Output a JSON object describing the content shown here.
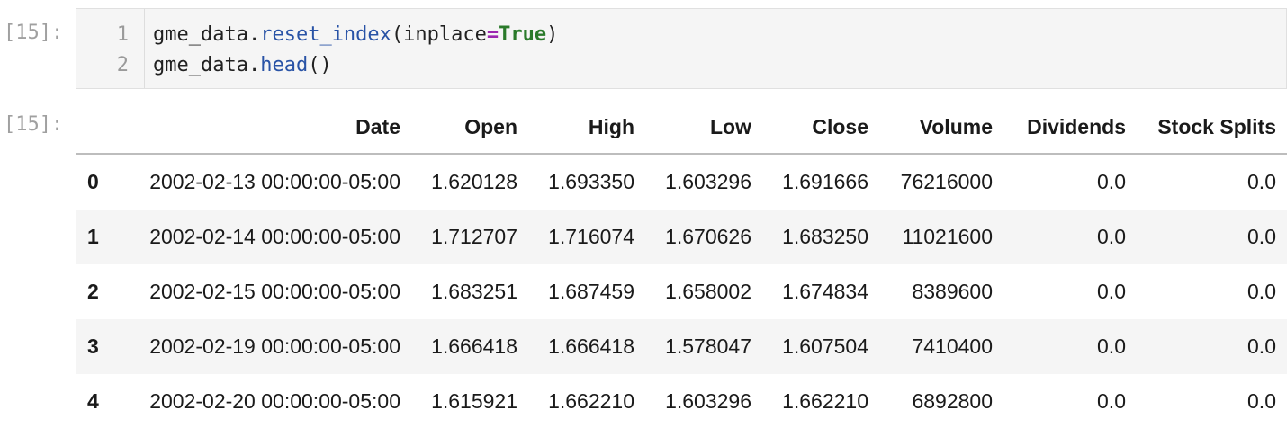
{
  "cell": {
    "input_prompt": "[15]:",
    "output_prompt": "[15]:",
    "line_numbers": [
      "1",
      "2"
    ],
    "code_lines": [
      [
        {
          "t": "gme_data.",
          "c": "plain"
        },
        {
          "t": "reset_index",
          "c": "attr"
        },
        {
          "t": "(inplace",
          "c": "plain"
        },
        {
          "t": "=",
          "c": "op"
        },
        {
          "t": "True",
          "c": "kw"
        },
        {
          "t": ")",
          "c": "plain"
        }
      ],
      [
        {
          "t": "gme_data.",
          "c": "plain"
        },
        {
          "t": "head",
          "c": "attr"
        },
        {
          "t": "()",
          "c": "plain"
        }
      ]
    ]
  },
  "table": {
    "columns": [
      "",
      "Date",
      "Open",
      "High",
      "Low",
      "Close",
      "Volume",
      "Dividends",
      "Stock Splits"
    ],
    "rows": [
      {
        "index": "0",
        "cells": [
          "2002-02-13 00:00:00-05:00",
          "1.620128",
          "1.693350",
          "1.603296",
          "1.691666",
          "76216000",
          "0.0",
          "0.0"
        ]
      },
      {
        "index": "1",
        "cells": [
          "2002-02-14 00:00:00-05:00",
          "1.712707",
          "1.716074",
          "1.670626",
          "1.683250",
          "11021600",
          "0.0",
          "0.0"
        ]
      },
      {
        "index": "2",
        "cells": [
          "2002-02-15 00:00:00-05:00",
          "1.683251",
          "1.687459",
          "1.658002",
          "1.674834",
          "8389600",
          "0.0",
          "0.0"
        ]
      },
      {
        "index": "3",
        "cells": [
          "2002-02-19 00:00:00-05:00",
          "1.666418",
          "1.666418",
          "1.578047",
          "1.607504",
          "7410400",
          "0.0",
          "0.0"
        ]
      },
      {
        "index": "4",
        "cells": [
          "2002-02-20 00:00:00-05:00",
          "1.615921",
          "1.662210",
          "1.603296",
          "1.662210",
          "6892800",
          "0.0",
          "0.0"
        ]
      }
    ]
  },
  "colors": {
    "attr": "#2953a6",
    "op": "#9c27b0",
    "kw": "#2a7a2a",
    "prompt": "#a0a0a0",
    "stripe": "#f5f5f5"
  }
}
